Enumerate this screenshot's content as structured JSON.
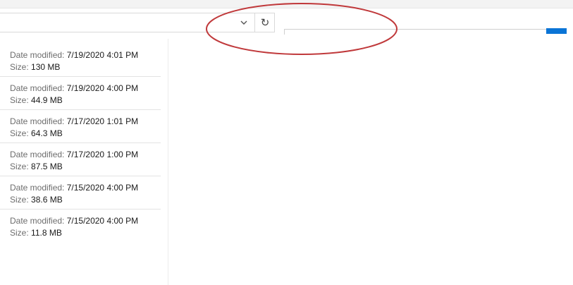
{
  "labels": {
    "date_modified": "Date modified:",
    "size": "Size:"
  },
  "files": [
    {
      "date": "7/19/2020 4:01 PM",
      "size": "130 MB"
    },
    {
      "date": "7/19/2020 4:00 PM",
      "size": "44.9 MB"
    },
    {
      "date": "7/17/2020 1:01 PM",
      "size": "64.3 MB"
    },
    {
      "date": "7/17/2020 1:00 PM",
      "size": "87.5 MB"
    },
    {
      "date": "7/15/2020 4:00 PM",
      "size": "38.6 MB"
    },
    {
      "date": "7/15/2020 4:00 PM",
      "size": "11.8 MB"
    }
  ],
  "toolbar": {
    "refresh_glyph": "↻"
  },
  "colors": {
    "accent": "#0a74d6",
    "annotation": "#c0393b"
  }
}
